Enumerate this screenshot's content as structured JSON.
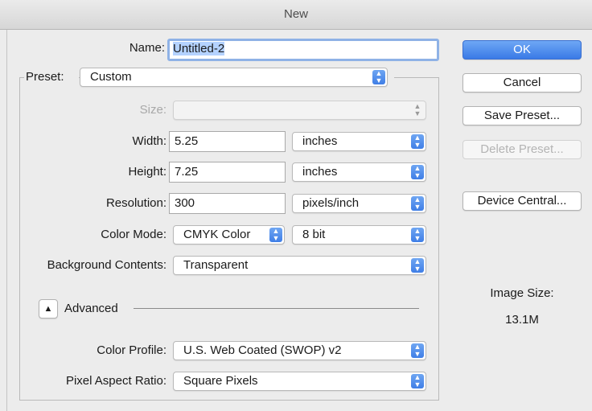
{
  "window": {
    "title": "New"
  },
  "form": {
    "name_label": "Name:",
    "name_value": "Untitled-2",
    "preset_label": "Preset:",
    "preset_value": "Custom",
    "size_label": "Size:",
    "size_value": "",
    "width_label": "Width:",
    "width_value": "5.25",
    "width_unit": "inches",
    "height_label": "Height:",
    "height_value": "7.25",
    "height_unit": "inches",
    "resolution_label": "Resolution:",
    "resolution_value": "300",
    "resolution_unit": "pixels/inch",
    "color_mode_label": "Color Mode:",
    "color_mode_value": "CMYK Color",
    "bit_depth_value": "8 bit",
    "background_label": "Background Contents:",
    "background_value": "Transparent",
    "advanced_label": "Advanced",
    "color_profile_label": "Color Profile:",
    "color_profile_value": "U.S. Web Coated (SWOP) v2",
    "pixel_aspect_label": "Pixel Aspect Ratio:",
    "pixel_aspect_value": "Square Pixels"
  },
  "buttons": {
    "ok": "OK",
    "cancel": "Cancel",
    "save_preset": "Save Preset...",
    "delete_preset": "Delete Preset...",
    "device_central": "Device Central..."
  },
  "image_size": {
    "label": "Image Size:",
    "value": "13.1M"
  },
  "colors": {
    "accent": "#3f7ee6",
    "focus_ring": "#8fb2e6",
    "selection": "#b4d2ff",
    "background": "#ececec"
  },
  "icons": {
    "stepper": "chevron-up-down-icon",
    "disclosure": "triangle-up-icon"
  }
}
